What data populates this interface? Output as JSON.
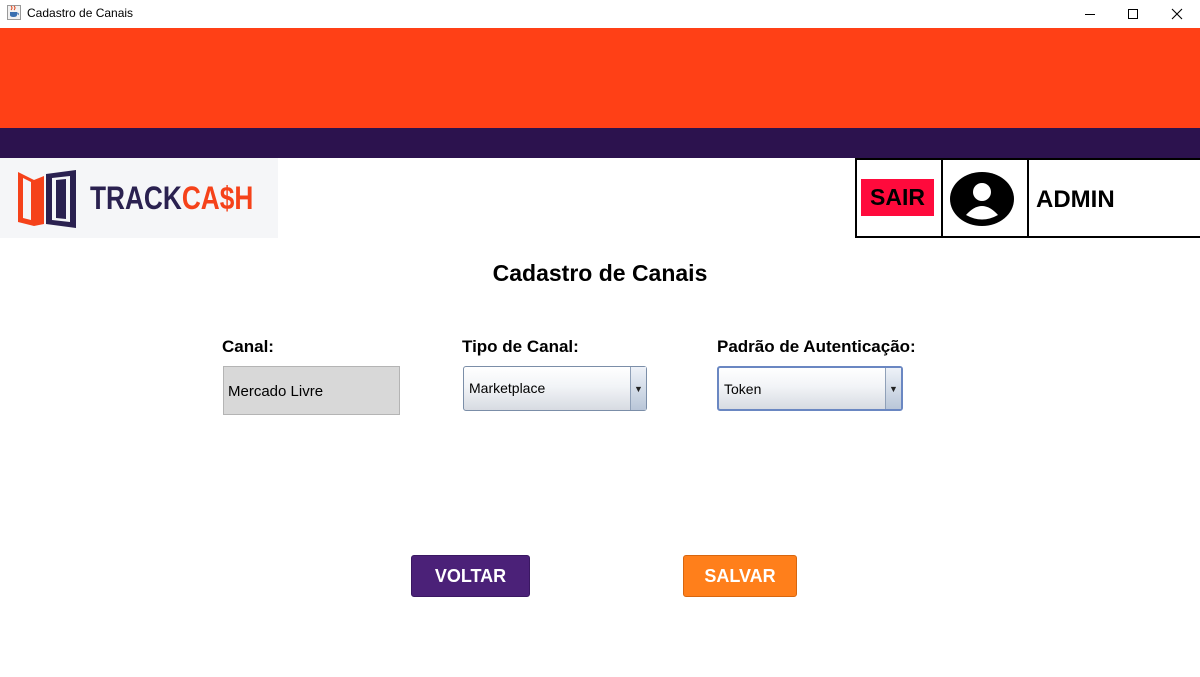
{
  "window": {
    "title": "Cadastro de Canais",
    "icon": "java-cup-icon",
    "controls": [
      "minimize",
      "maximize",
      "close"
    ]
  },
  "colors": {
    "orange_band": "#ff4016",
    "purple_band": "#2c124e",
    "sair_button": "#ff0a3c",
    "voltar_button": "#4b2178",
    "salvar_button": "#ff7f1b"
  },
  "header": {
    "logo": {
      "part1": "TRACK",
      "part2": "CA$H"
    },
    "logout_label": "SAIR",
    "avatar_icon": "user-circle-icon",
    "user_name": "ADMIN"
  },
  "page": {
    "title": "Cadastro de Canais"
  },
  "form": {
    "canal": {
      "label": "Canal:",
      "value": "Mercado Livre"
    },
    "tipo_canal": {
      "label": "Tipo de Canal:",
      "value": "Marketplace"
    },
    "padrao_autenticacao": {
      "label": "Padrão de Autenticação:",
      "value": "Token"
    }
  },
  "actions": {
    "back_label": "VOLTAR",
    "save_label": "SALVAR"
  }
}
